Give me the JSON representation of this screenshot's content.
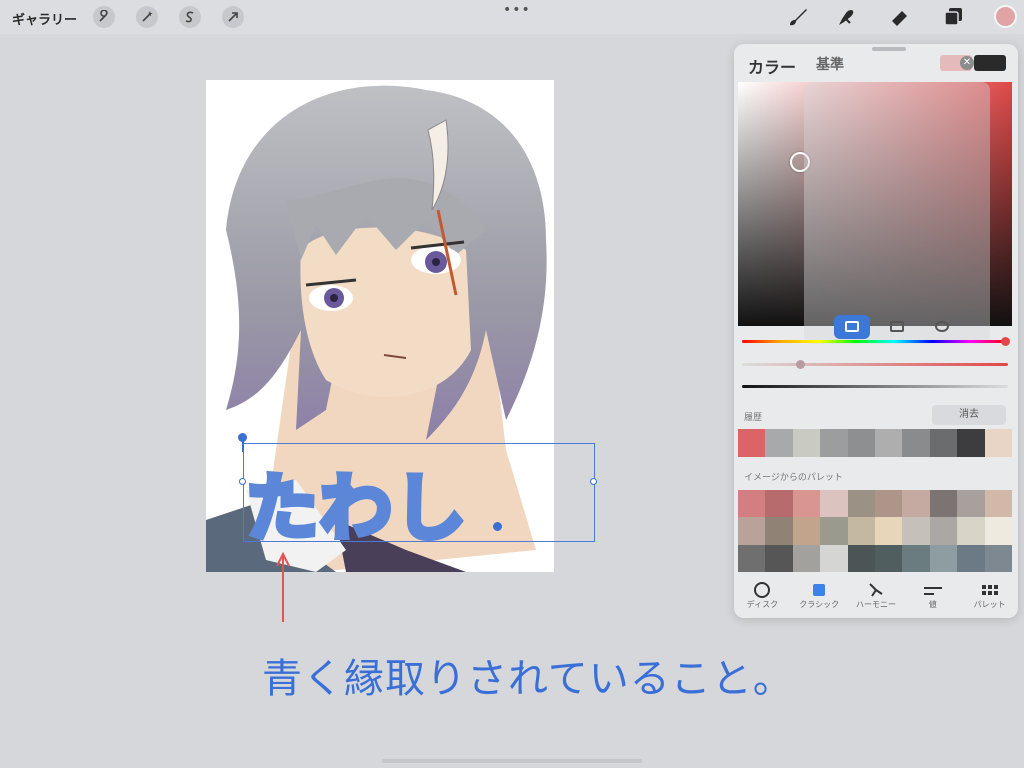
{
  "toolbar": {
    "gallery_label": "ギャラリー",
    "left_tools": [
      "wrench-icon",
      "magic-wand-icon",
      "selection-s-icon",
      "transform-arrow-icon"
    ],
    "center_dots": "•••",
    "right_tools": [
      "brush-icon",
      "smudge-icon",
      "eraser-icon",
      "layers-icon"
    ],
    "current_color": "#e0a3a6"
  },
  "canvas": {
    "text_layer": "たわし"
  },
  "annotation": {
    "note": "青く縁取りされていること。",
    "accent_color": "#3b6fd8"
  },
  "color_panel": {
    "title": "カラー",
    "reference_label": "基準",
    "primary_swatch": "#e6b9bb",
    "secondary_swatch": "#2a2a2a",
    "history_label": "履歴",
    "clear_label": "消去",
    "history_colors": [
      "#dc6466",
      "#a7a9ab",
      "#c9cac2",
      "#9c9d9f",
      "#8e8f91",
      "#aeaeae",
      "#8a8b8c",
      "#6b6c6e",
      "#3d3d3f",
      "#e8d5c5"
    ],
    "palette_label": "イメージからのパレット",
    "palette_colors": [
      "#d37f82",
      "#b86b6d",
      "#d99691",
      "#dcc3c0",
      "#9b9185",
      "#ae958a",
      "#c5aaa2",
      "#7c7472",
      "#a8a09c",
      "#d1b8a8",
      "#b8a29a",
      "#908375",
      "#c2a38c",
      "#9a9a8e",
      "#c5b8a1",
      "#e8d6bb",
      "#c5c0ba",
      "#aaa7a4",
      "#d8d4c8",
      "#eeeae0",
      "#6f6f70",
      "#565657",
      "#a2a19e",
      "#d5d6d3",
      "#4c5556",
      "#515e5f",
      "#6a7c80",
      "#8e9da2",
      "#6c7a85",
      "#7d8891"
    ],
    "tabs": [
      {
        "label": "ディスク"
      },
      {
        "label": "クラシック"
      },
      {
        "label": "ハーモニー"
      },
      {
        "label": "値"
      },
      {
        "label": "パレット"
      }
    ]
  }
}
